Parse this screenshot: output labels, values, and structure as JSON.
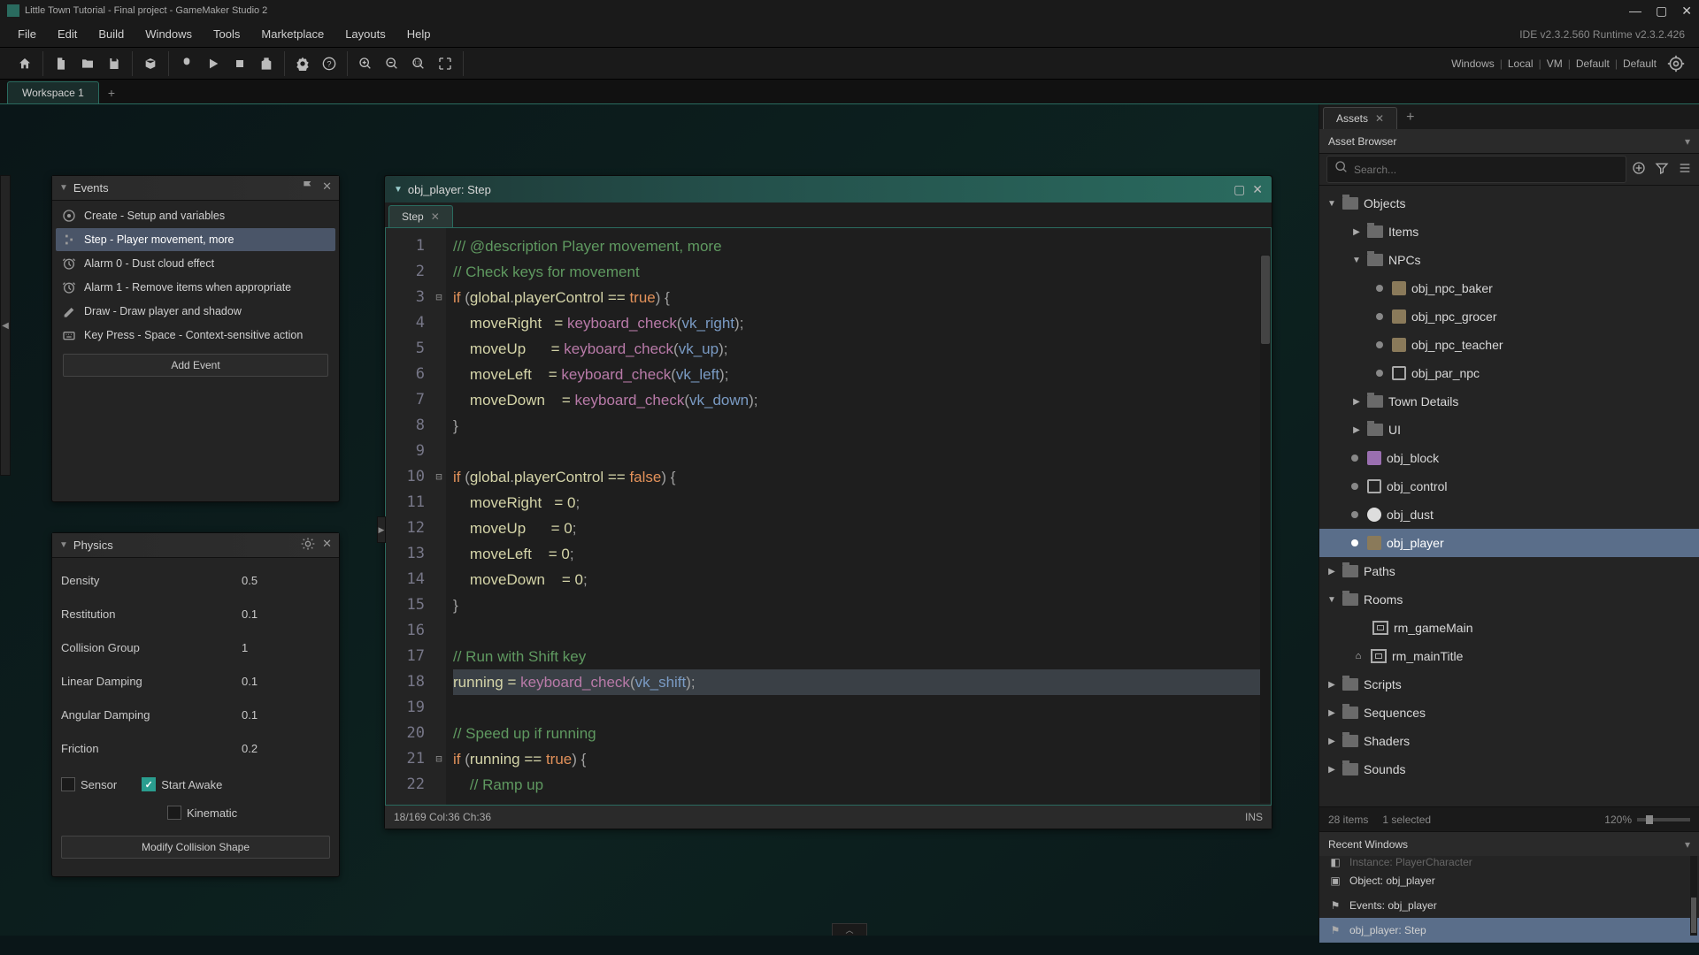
{
  "titlebar": {
    "title": "Little Town Tutorial - Final project - GameMaker Studio 2"
  },
  "menubar": {
    "items": [
      "File",
      "Edit",
      "Build",
      "Windows",
      "Tools",
      "Marketplace",
      "Layouts",
      "Help"
    ],
    "version": "IDE v2.3.2.560  Runtime v2.3.2.426"
  },
  "toolbar_right": {
    "items": [
      "Windows",
      "Local",
      "VM",
      "Default",
      "Default"
    ]
  },
  "workspace_tabs": {
    "tab1": "Workspace 1"
  },
  "events_panel": {
    "title": "Events",
    "items": [
      {
        "label": "Create - Setup and variables"
      },
      {
        "label": "Step - Player movement, more"
      },
      {
        "label": "Alarm 0 - Dust cloud effect"
      },
      {
        "label": "Alarm 1 - Remove items when appropriate"
      },
      {
        "label": "Draw - Draw player and shadow"
      },
      {
        "label": "Key Press - Space - Context-sensitive action"
      }
    ],
    "add_event": "Add Event"
  },
  "physics_panel": {
    "title": "Physics",
    "rows": [
      {
        "label": "Density",
        "value": "0.5"
      },
      {
        "label": "Restitution",
        "value": "0.1"
      },
      {
        "label": "Collision Group",
        "value": "1"
      },
      {
        "label": "Linear Damping",
        "value": "0.1"
      },
      {
        "label": "Angular Damping",
        "value": "0.1"
      },
      {
        "label": "Friction",
        "value": "0.2"
      }
    ],
    "sensor": "Sensor",
    "start_awake": "Start Awake",
    "kinematic": "Kinematic",
    "modify": "Modify Collision Shape"
  },
  "code_panel": {
    "title": "obj_player: Step",
    "tab": "Step",
    "statusbar_left": "18/169 Col:36 Ch:36",
    "statusbar_right": "INS"
  },
  "assets": {
    "tab": "Assets",
    "browser_title": "Asset Browser",
    "search_placeholder": "Search...",
    "statusbar_items": "28 items",
    "statusbar_selected": "1 selected",
    "statusbar_zoom": "120%",
    "recent_title": "Recent Windows",
    "tree": {
      "objects": "Objects",
      "items": "Items",
      "npcs": "NPCs",
      "npc_baker": "obj_npc_baker",
      "npc_grocer": "obj_npc_grocer",
      "npc_teacher": "obj_npc_teacher",
      "par_npc": "obj_par_npc",
      "town_details": "Town Details",
      "ui": "UI",
      "obj_block": "obj_block",
      "obj_control": "obj_control",
      "obj_dust": "obj_dust",
      "obj_player": "obj_player",
      "paths": "Paths",
      "rooms": "Rooms",
      "rm_gameMain": "rm_gameMain",
      "rm_mainTitle": "rm_mainTitle",
      "scripts": "Scripts",
      "sequences": "Sequences",
      "shaders": "Shaders",
      "sounds": "Sounds"
    },
    "recent": {
      "item0": "Instance: PlayerCharacter",
      "item1": "Object: obj_player",
      "item2": "Events: obj_player",
      "item3": "obj_player: Step"
    }
  }
}
